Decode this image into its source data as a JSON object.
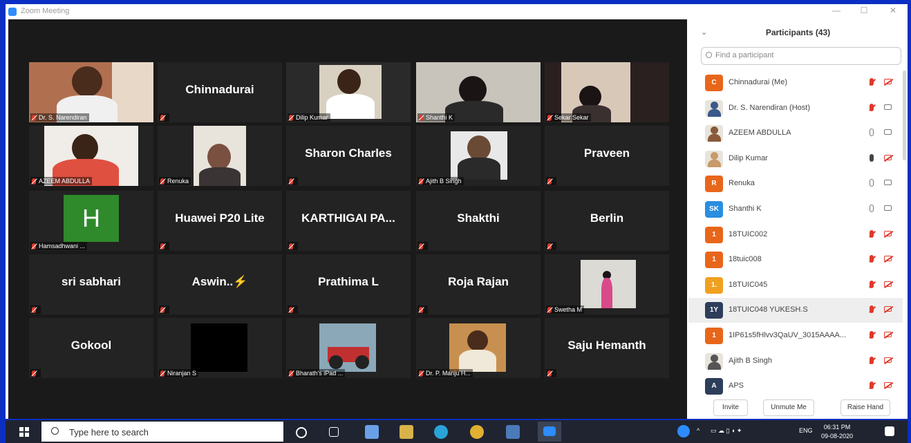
{
  "window": {
    "title": "Zoom Meeting",
    "minimize": "—",
    "maximize": "☐",
    "close": "✕"
  },
  "tiles": [
    {
      "kind": "video",
      "label": "Dr. S. Narendiran"
    },
    {
      "kind": "name",
      "name": "Chinnadurai"
    },
    {
      "kind": "video",
      "label": "Dilip Kumar",
      "highlight": true
    },
    {
      "kind": "video",
      "label": "Shanthi K"
    },
    {
      "kind": "video",
      "label": "Sekar Sekar"
    },
    {
      "kind": "video",
      "label": "AZEEM ABDULLA"
    },
    {
      "kind": "video",
      "label": "Renuka"
    },
    {
      "kind": "name",
      "name": "Sharon Charles"
    },
    {
      "kind": "video",
      "label": "Ajith B Singh"
    },
    {
      "kind": "name",
      "name": "Praveen"
    },
    {
      "kind": "avatar",
      "letter": "H",
      "label": "Hamsadhwani ..."
    },
    {
      "kind": "name",
      "name": "Huawei P20 Lite"
    },
    {
      "kind": "name",
      "name": "KARTHIGAI  PA..."
    },
    {
      "kind": "name",
      "name": "Shakthi"
    },
    {
      "kind": "name",
      "name": "Berlin"
    },
    {
      "kind": "name",
      "name": "sri sabhari"
    },
    {
      "kind": "name",
      "name": "Aswin..⚡"
    },
    {
      "kind": "name",
      "name": "Prathima L"
    },
    {
      "kind": "name",
      "name": "Roja Rajan"
    },
    {
      "kind": "video",
      "label": "Swetha M"
    },
    {
      "kind": "name",
      "name": "Gokool"
    },
    {
      "kind": "video",
      "label": "Niranjan S"
    },
    {
      "kind": "video",
      "label": "Bharath's iPad ..."
    },
    {
      "kind": "video",
      "label": "Dr. P. Manju H..."
    },
    {
      "kind": "name",
      "name": "Saju Hemanth"
    }
  ],
  "participants_panel": {
    "title": "Participants (43)",
    "collapse_icon": "chevron-down-icon",
    "search_placeholder": "Find a participant",
    "items": [
      {
        "name": "Chinnadurai (Me)",
        "avatar": "C",
        "color": "#e8661a",
        "mic": "muted",
        "cam": "off"
      },
      {
        "name": "Dr. S. Narendiran (Host)",
        "avatar": "photo",
        "color": "#3a5a8a",
        "mic": "muted",
        "cam": "on"
      },
      {
        "name": "AZEEM ABDULLA",
        "avatar": "photo",
        "color": "#8a5a3a",
        "mic": "on",
        "cam": "on"
      },
      {
        "name": "Dilip Kumar",
        "avatar": "photo",
        "color": "#c99a6a",
        "mic": "talk",
        "cam": "off"
      },
      {
        "name": "Renuka",
        "avatar": "R",
        "color": "#e8661a",
        "mic": "on",
        "cam": "on"
      },
      {
        "name": "Shanthi K",
        "avatar": "SK",
        "color": "#2a8ee0",
        "mic": "on",
        "cam": "on"
      },
      {
        "name": "18TUIC002",
        "avatar": "1",
        "color": "#e8661a",
        "mic": "muted",
        "cam": "off"
      },
      {
        "name": "18tuic008",
        "avatar": "1",
        "color": "#e8661a",
        "mic": "muted",
        "cam": "off"
      },
      {
        "name": "18TUIC045",
        "avatar": "1.",
        "color": "#f0a020",
        "mic": "muted",
        "cam": "off"
      },
      {
        "name": "18TUIC048 YUKESH.S",
        "avatar": "1Y",
        "color": "#2d3e5a",
        "mic": "muted",
        "cam": "off",
        "selected": true
      },
      {
        "name": "1IP61s5fHlvv3QaUV_3015AAAA...",
        "avatar": "1",
        "color": "#e8661a",
        "mic": "muted",
        "cam": "off"
      },
      {
        "name": "Ajith B Singh",
        "avatar": "photo",
        "color": "#555",
        "mic": "muted",
        "cam": "off"
      },
      {
        "name": "APS",
        "avatar": "A",
        "color": "#2d3e5a",
        "mic": "muted",
        "cam": "off"
      }
    ],
    "buttons": [
      "Invite",
      "Unmute Me",
      "Raise Hand"
    ]
  },
  "taskbar": {
    "search_placeholder": "Type here to search",
    "language": "ENG",
    "time": "06:31 PM",
    "date": "09-08-2020"
  }
}
